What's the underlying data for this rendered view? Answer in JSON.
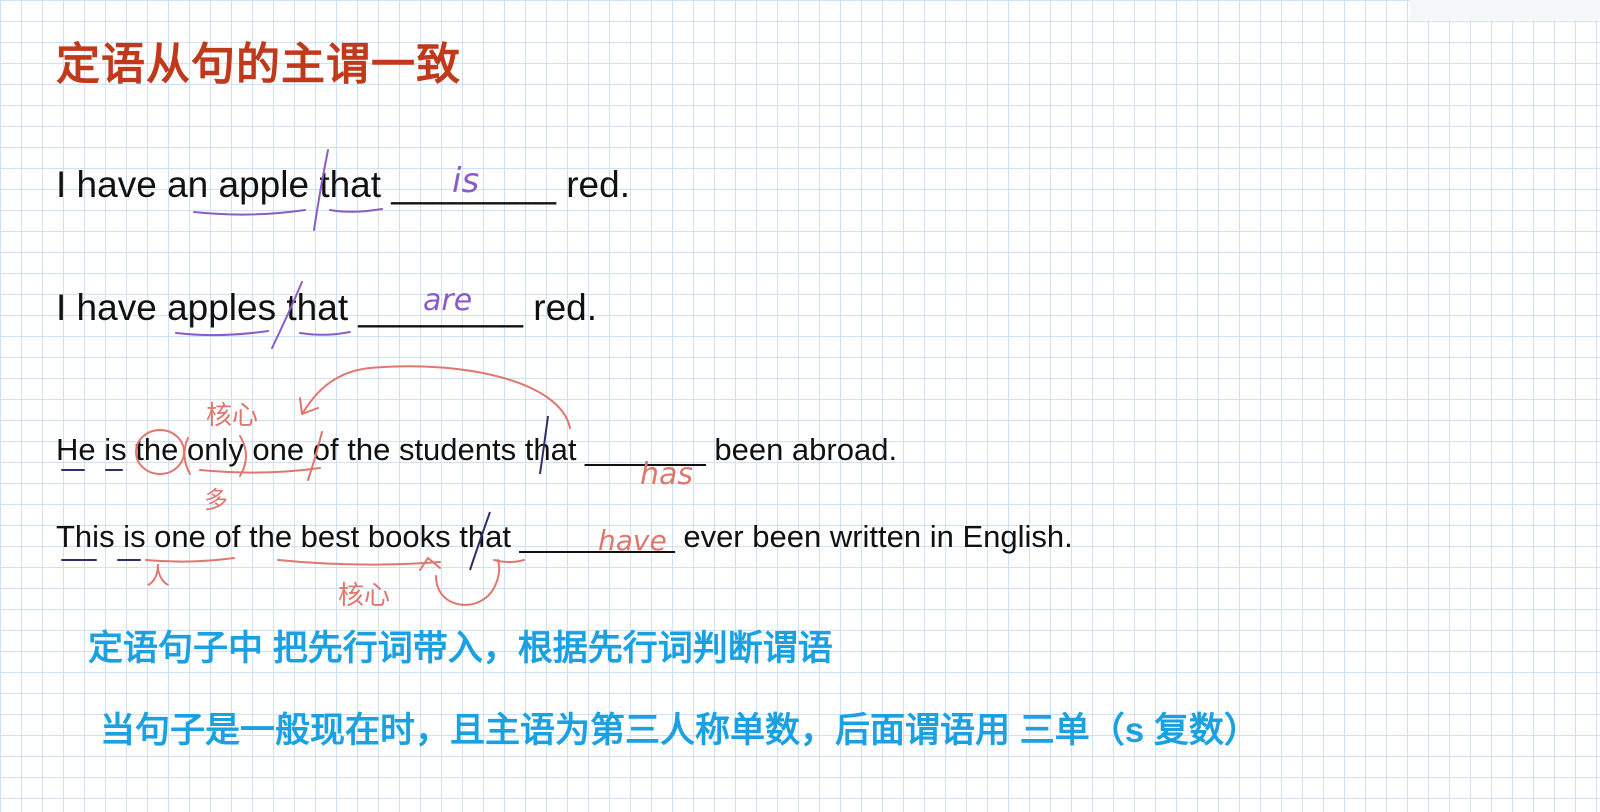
{
  "slide": {
    "title": "定语从句的主谓一致",
    "sentences": [
      "I have an apple that ________ red.",
      "I have apples that ________ red.",
      "He is the only one of the students that _______ been abroad.",
      "This is one of the best books that _________ ever been written in English."
    ],
    "rules": [
      "定语句子中 把先行词带入，根据先行词判断谓语",
      "当句子是一般现在时，且主语为第三人称单数，后面谓语用 三单（s  复数）"
    ]
  },
  "annotations": {
    "answer_1": "is",
    "answer_2": "are",
    "answer_3": "has",
    "answer_4": "have",
    "core_label_1": "核心",
    "core_label_2": "核心",
    "note_many": "多",
    "note_person": "人"
  },
  "colors": {
    "title": "#c0391b",
    "rule_text": "#1ba1e2",
    "ink_purple": "#8a5cc7",
    "ink_red": "#e0776e",
    "ink_navy": "#2e2e6a",
    "grid": "#cfe2f3"
  }
}
